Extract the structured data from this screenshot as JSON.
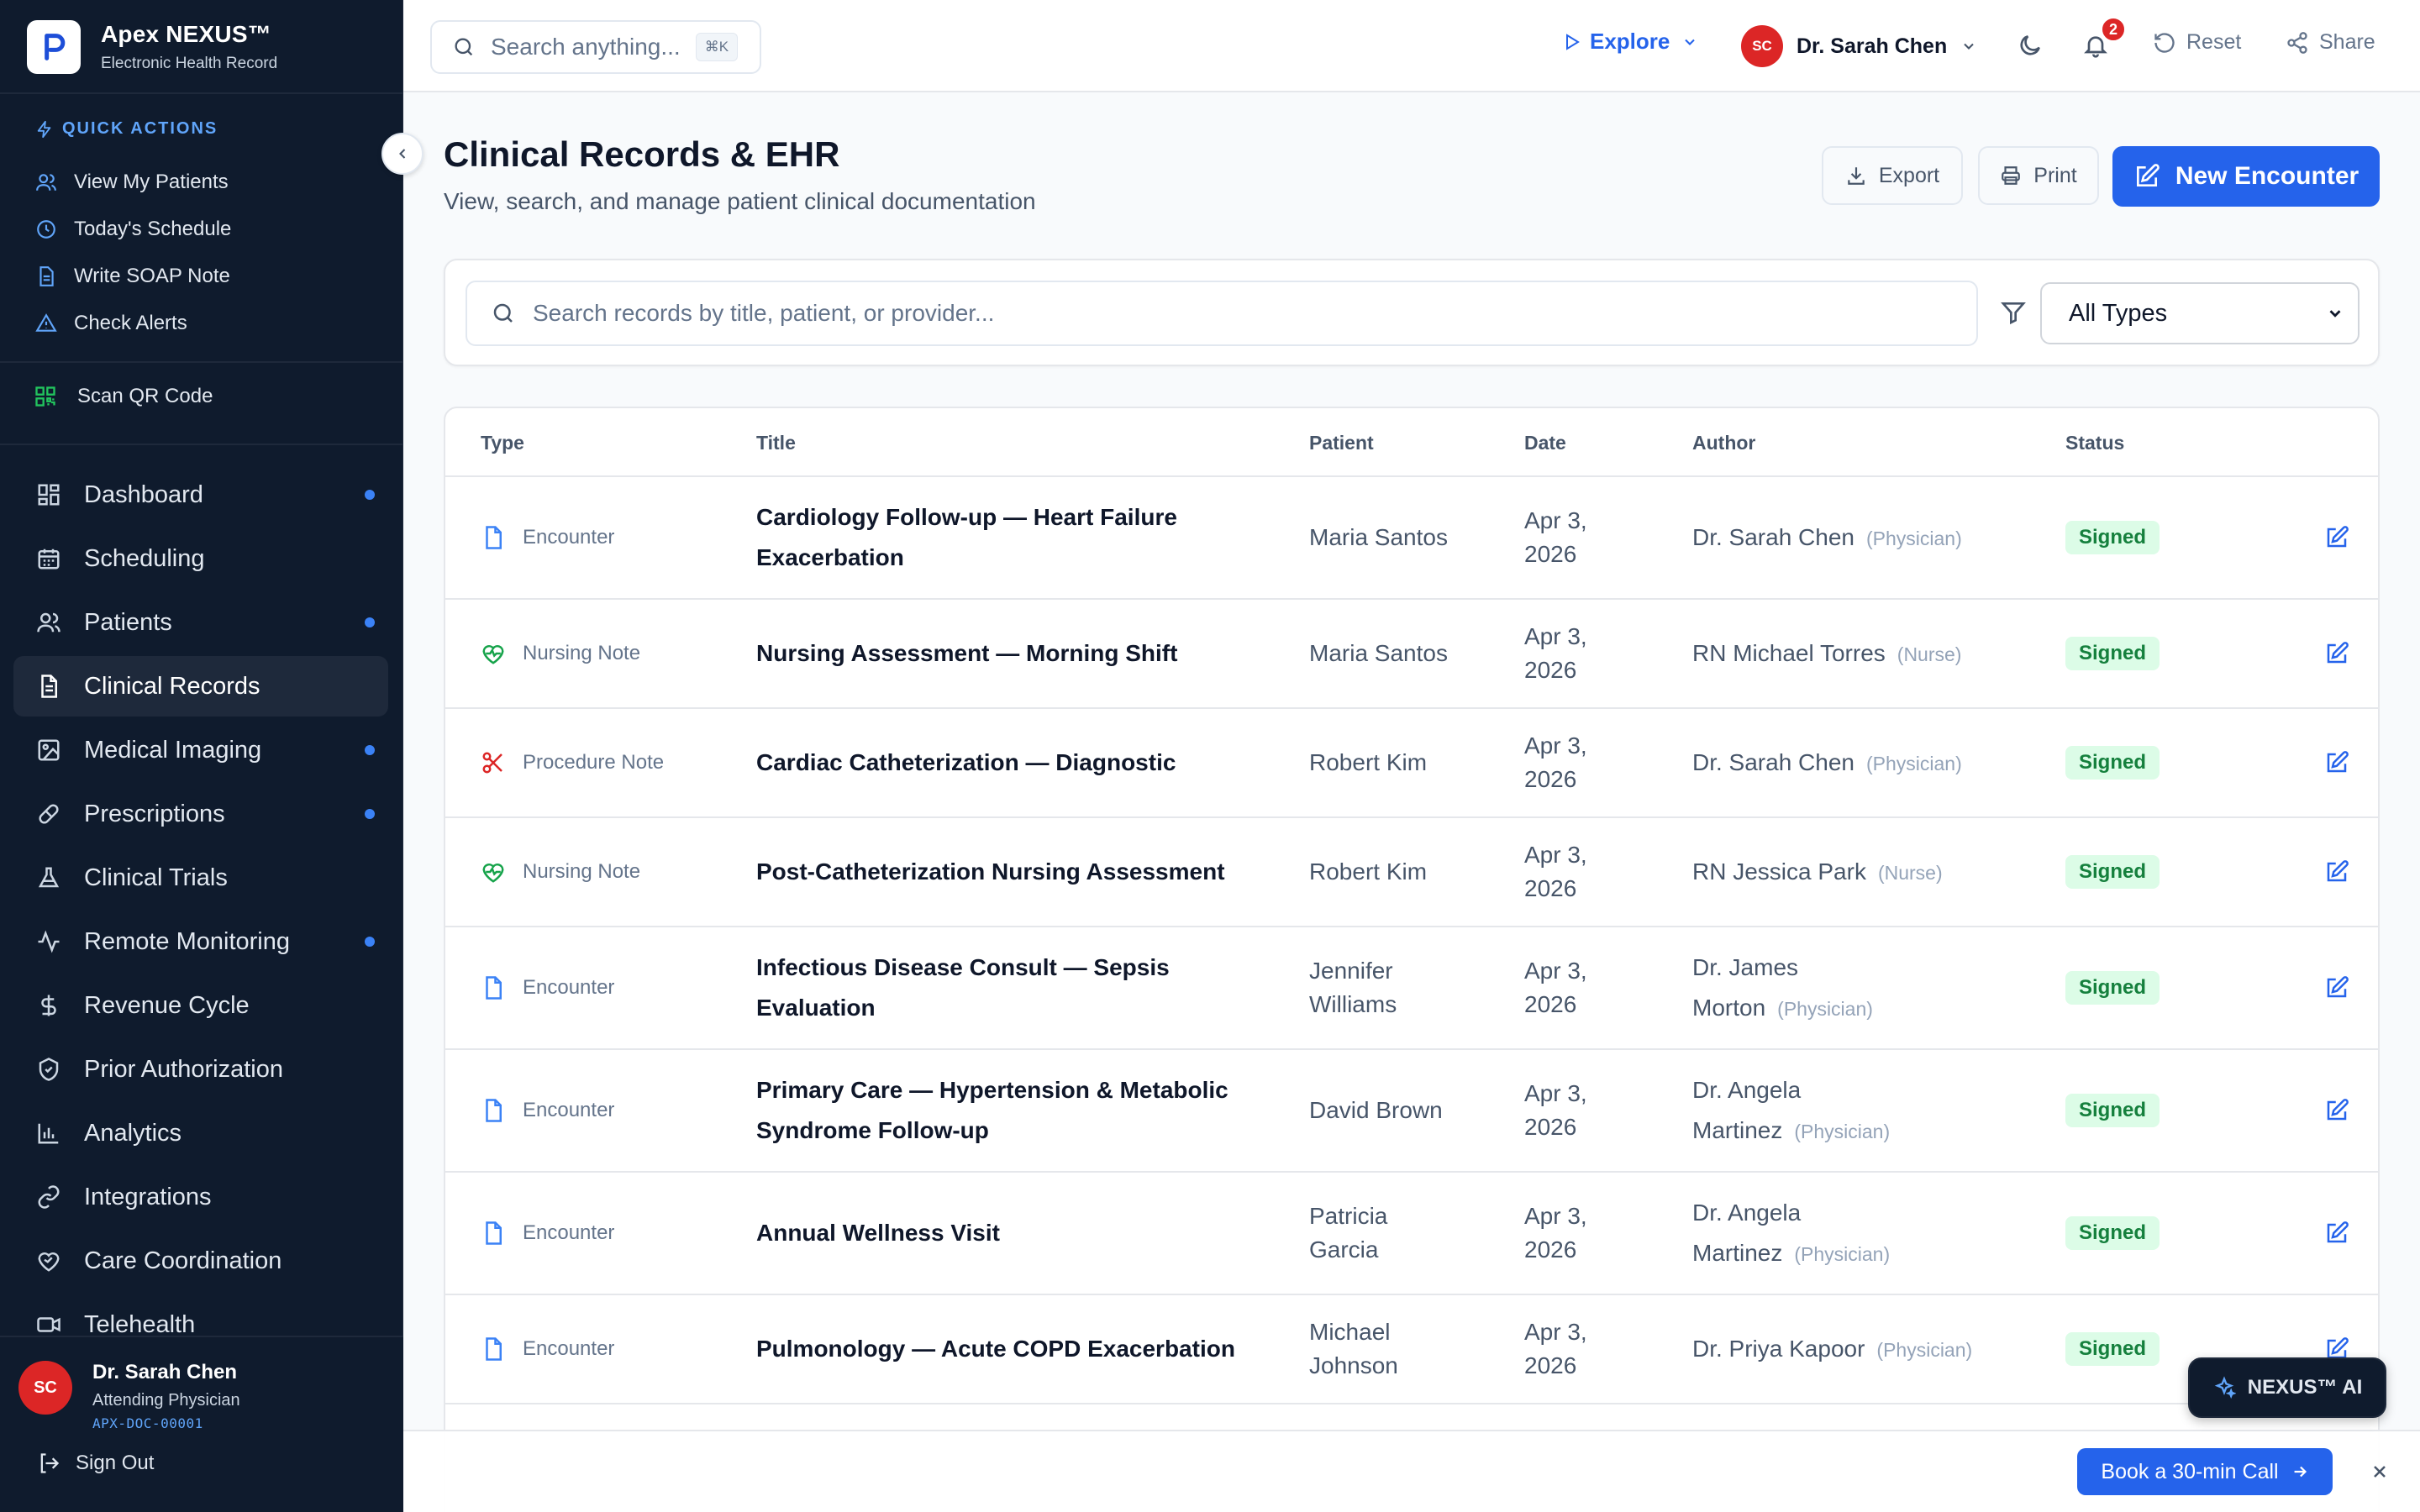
{
  "brand": {
    "name": "Apex NEXUS™",
    "subtitle": "Electronic Health Record",
    "logo_letter": "P"
  },
  "quick_actions": {
    "title": "QUICK ACTIONS",
    "items": [
      {
        "label": "View My Patients",
        "icon": "users-icon"
      },
      {
        "label": "Today's Schedule",
        "icon": "clock-icon"
      },
      {
        "label": "Write SOAP Note",
        "icon": "document-icon"
      },
      {
        "label": "Check Alerts",
        "icon": "alert-triangle-icon"
      }
    ]
  },
  "scan": {
    "label": "Scan QR Code",
    "icon": "qr-code-icon"
  },
  "nav": {
    "items": [
      {
        "label": "Dashboard",
        "icon": "grid-icon",
        "dot": true
      },
      {
        "label": "Scheduling",
        "icon": "calendar-icon",
        "dot": false
      },
      {
        "label": "Patients",
        "icon": "users-icon",
        "dot": true
      },
      {
        "label": "Clinical Records",
        "icon": "file-text-icon",
        "dot": false,
        "active": true
      },
      {
        "label": "Medical Imaging",
        "icon": "image-icon",
        "dot": true
      },
      {
        "label": "Prescriptions",
        "icon": "pill-icon",
        "dot": true
      },
      {
        "label": "Clinical Trials",
        "icon": "flask-icon",
        "dot": false
      },
      {
        "label": "Remote Monitoring",
        "icon": "activity-icon",
        "dot": true
      },
      {
        "label": "Revenue Cycle",
        "icon": "dollar-icon",
        "dot": false
      },
      {
        "label": "Prior Authorization",
        "icon": "shield-check-icon",
        "dot": false
      },
      {
        "label": "Analytics",
        "icon": "bar-chart-icon",
        "dot": false
      },
      {
        "label": "Integrations",
        "icon": "link-icon",
        "dot": false
      },
      {
        "label": "Care Coordination",
        "icon": "heart-handshake-icon",
        "dot": false
      },
      {
        "label": "Telehealth",
        "icon": "video-icon",
        "dot": false
      }
    ]
  },
  "sidebar_user": {
    "initials": "SC",
    "name": "Dr. Sarah Chen",
    "role": "Attending Physician",
    "id": "APX-DOC-00001"
  },
  "signout": {
    "label": "Sign Out"
  },
  "topbar": {
    "search_placeholder": "Search anything...",
    "shortcut": "⌘K",
    "explore_label": "Explore",
    "user_initials": "SC",
    "user_name": "Dr. Sarah Chen",
    "notification_count": "2",
    "reset_label": "Reset",
    "share_label": "Share"
  },
  "page": {
    "title": "Clinical Records & EHR",
    "subtitle": "View, search, and manage patient clinical documentation",
    "export_label": "Export",
    "print_label": "Print",
    "new_label": "New Encounter"
  },
  "filters": {
    "search_placeholder": "Search records by title, patient, or provider...",
    "type_selected": "All Types"
  },
  "table": {
    "columns": [
      "Type",
      "Title",
      "Patient",
      "Date",
      "Author",
      "Status"
    ],
    "rows": [
      {
        "type": "Encounter",
        "type_icon": "document-icon",
        "title": "Cardiology Follow-up — Heart Failure Exacerbation",
        "patient": "Maria Santos",
        "date": "Apr 3, 2026",
        "author": "Dr. Sarah Chen",
        "role": "(Physician)",
        "status": "Signed"
      },
      {
        "type": "Nursing Note",
        "type_icon": "heart-pulse-icon",
        "title": "Nursing Assessment — Morning Shift",
        "patient": "Maria Santos",
        "date": "Apr 3, 2026",
        "author": "RN Michael Torres",
        "role": "(Nurse)",
        "status": "Signed"
      },
      {
        "type": "Procedure Note",
        "type_icon": "scissors-icon",
        "title": "Cardiac Catheterization — Diagnostic",
        "patient": "Robert Kim",
        "date": "Apr 3, 2026",
        "author": "Dr. Sarah Chen",
        "role": "(Physician)",
        "status": "Signed"
      },
      {
        "type": "Nursing Note",
        "type_icon": "heart-pulse-icon",
        "title": "Post-Catheterization Nursing Assessment",
        "patient": "Robert Kim",
        "date": "Apr 3, 2026",
        "author": "RN Jessica Park",
        "role": "(Nurse)",
        "status": "Signed"
      },
      {
        "type": "Encounter",
        "type_icon": "document-icon",
        "title": "Infectious Disease Consult — Sepsis Evaluation",
        "patient": "Jennifer Williams",
        "date": "Apr 3, 2026",
        "author": "Dr. James Morton",
        "role": "(Physician)",
        "status": "Signed"
      },
      {
        "type": "Encounter",
        "type_icon": "document-icon",
        "title": "Primary Care — Hypertension & Metabolic Syndrome Follow-up",
        "patient": "David Brown",
        "date": "Apr 3, 2026",
        "author": "Dr. Angela Martinez",
        "role": "(Physician)",
        "status": "Signed"
      },
      {
        "type": "Encounter",
        "type_icon": "document-icon",
        "title": "Annual Wellness Visit",
        "patient": "Patricia Garcia",
        "date": "Apr 3, 2026",
        "author": "Dr. Angela Martinez",
        "role": "(Physician)",
        "status": "Signed"
      },
      {
        "type": "Encounter",
        "type_icon": "document-icon",
        "title": "Pulmonology — Acute COPD Exacerbation",
        "patient": "Michael Johnson",
        "date": "Apr 3, 2026",
        "author": "Dr. Priya Kapoor",
        "role": "(Physician)",
        "status": "Signed"
      }
    ]
  },
  "banner": {
    "cta_label": "Book a 30-min Call"
  },
  "ai": {
    "label": "NEXUS™ AI"
  },
  "colors": {
    "accent": "#2563eb",
    "sidebar_bg": "#0f1b2d",
    "status_signed": "#15803d",
    "alert_red": "#dc2626"
  }
}
